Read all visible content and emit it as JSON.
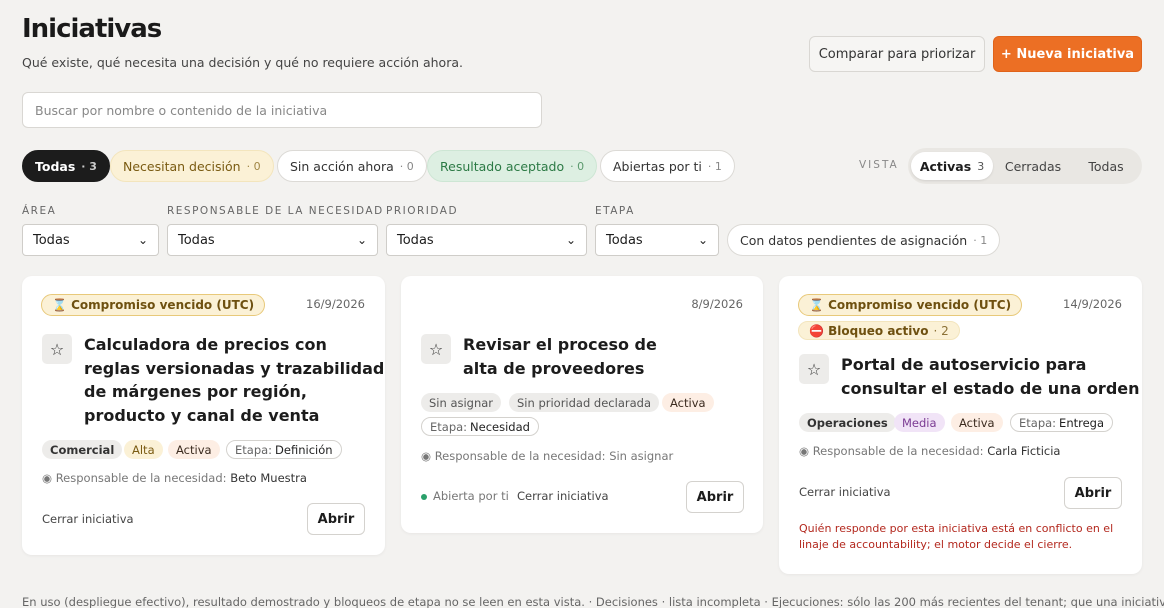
{
  "header": {
    "title": "Iniciativas",
    "subtitle": "Qué existe, qué necesita una decisión y qué no requiere acción ahora.",
    "compare_label": "Comparar para priorizar",
    "new_label": "+ Nueva iniciativa"
  },
  "search": {
    "placeholder": "Buscar por nombre o contenido de la iniciativa"
  },
  "filters": [
    {
      "label": "Todas",
      "count": "· 3"
    },
    {
      "label": "Necesitan decisión",
      "count": "· 0"
    },
    {
      "label": "Sin acción ahora",
      "count": "· 0"
    },
    {
      "label": "Resultado aceptado",
      "count": "· 0"
    },
    {
      "label": "Abiertas por ti",
      "count": "· 1"
    }
  ],
  "view": {
    "label": "VISTA",
    "options": [
      {
        "label": "Activas",
        "count": "3"
      },
      {
        "label": "Cerradas"
      },
      {
        "label": "Todas"
      }
    ]
  },
  "selects": [
    {
      "label": "ÁREA",
      "value": "Todas"
    },
    {
      "label": "RESPONSABLE DE LA NECESIDAD",
      "value": "Todas"
    },
    {
      "label": "PRIORIDAD",
      "value": "Todas"
    },
    {
      "label": "ETAPA",
      "value": "Todas"
    }
  ],
  "pending": {
    "label": "Con datos pendientes de asignación",
    "count": "· 1"
  },
  "cards": [
    {
      "badge": "⌛ Compromiso vencido (UTC)",
      "date": "16/9/2026",
      "title_lines": [
        "Calculadora de precios con",
        "reglas versionadas y trazabilidad",
        "de márgenes por región,",
        "producto y canal de venta"
      ],
      "tags": [
        "Comercial",
        "Alta",
        "Activa"
      ],
      "stage_key": "Etapa:",
      "stage_val": "Definición",
      "resp_key": "◉ Responsable de la necesidad:",
      "resp_val": "Beto Muestra",
      "close_label": "Cerrar iniciativa",
      "open_label": "Abrir"
    },
    {
      "date": "8/9/2026",
      "title_lines": [
        "Revisar el proceso de",
        "alta de proveedores"
      ],
      "tags": [
        "Sin asignar",
        "Sin prioridad declarada",
        "Activa"
      ],
      "stage_key": "Etapa:",
      "stage_val": "Necesidad",
      "resp_key": "◉ Responsable de la necesidad:",
      "resp_val": "Sin asignar",
      "opened_label": "Abierta por ti",
      "close_label": "Cerrar iniciativa",
      "open_label": "Abrir"
    },
    {
      "badge": "⌛ Compromiso vencido (UTC)",
      "block_badge": "⛔ Bloqueo activo",
      "block_count": "· 2",
      "date": "14/9/2026",
      "title_lines": [
        "Portal de autoservicio para",
        "consultar el estado de una orden"
      ],
      "tags": [
        "Operaciones",
        "Media",
        "Activa"
      ],
      "stage_key": "Etapa:",
      "stage_val": "Entrega",
      "resp_key": "◉ Responsable de la necesidad:",
      "resp_val": "Carla Ficticia",
      "close_label": "Cerrar iniciativa",
      "open_label": "Abrir",
      "warning_lines": [
        "Quién responde por esta iniciativa está en conflicto en el",
        "linaje de accountability; el motor decide el cierre."
      ]
    }
  ],
  "footer": "En uso (despliegue efectivo), resultado demostrado y bloqueos de etapa no se leen en esta vista. · Decisiones · lista incompleta · Ejecuciones: sólo las 200 más recientes del tenant; que una iniciativa"
}
